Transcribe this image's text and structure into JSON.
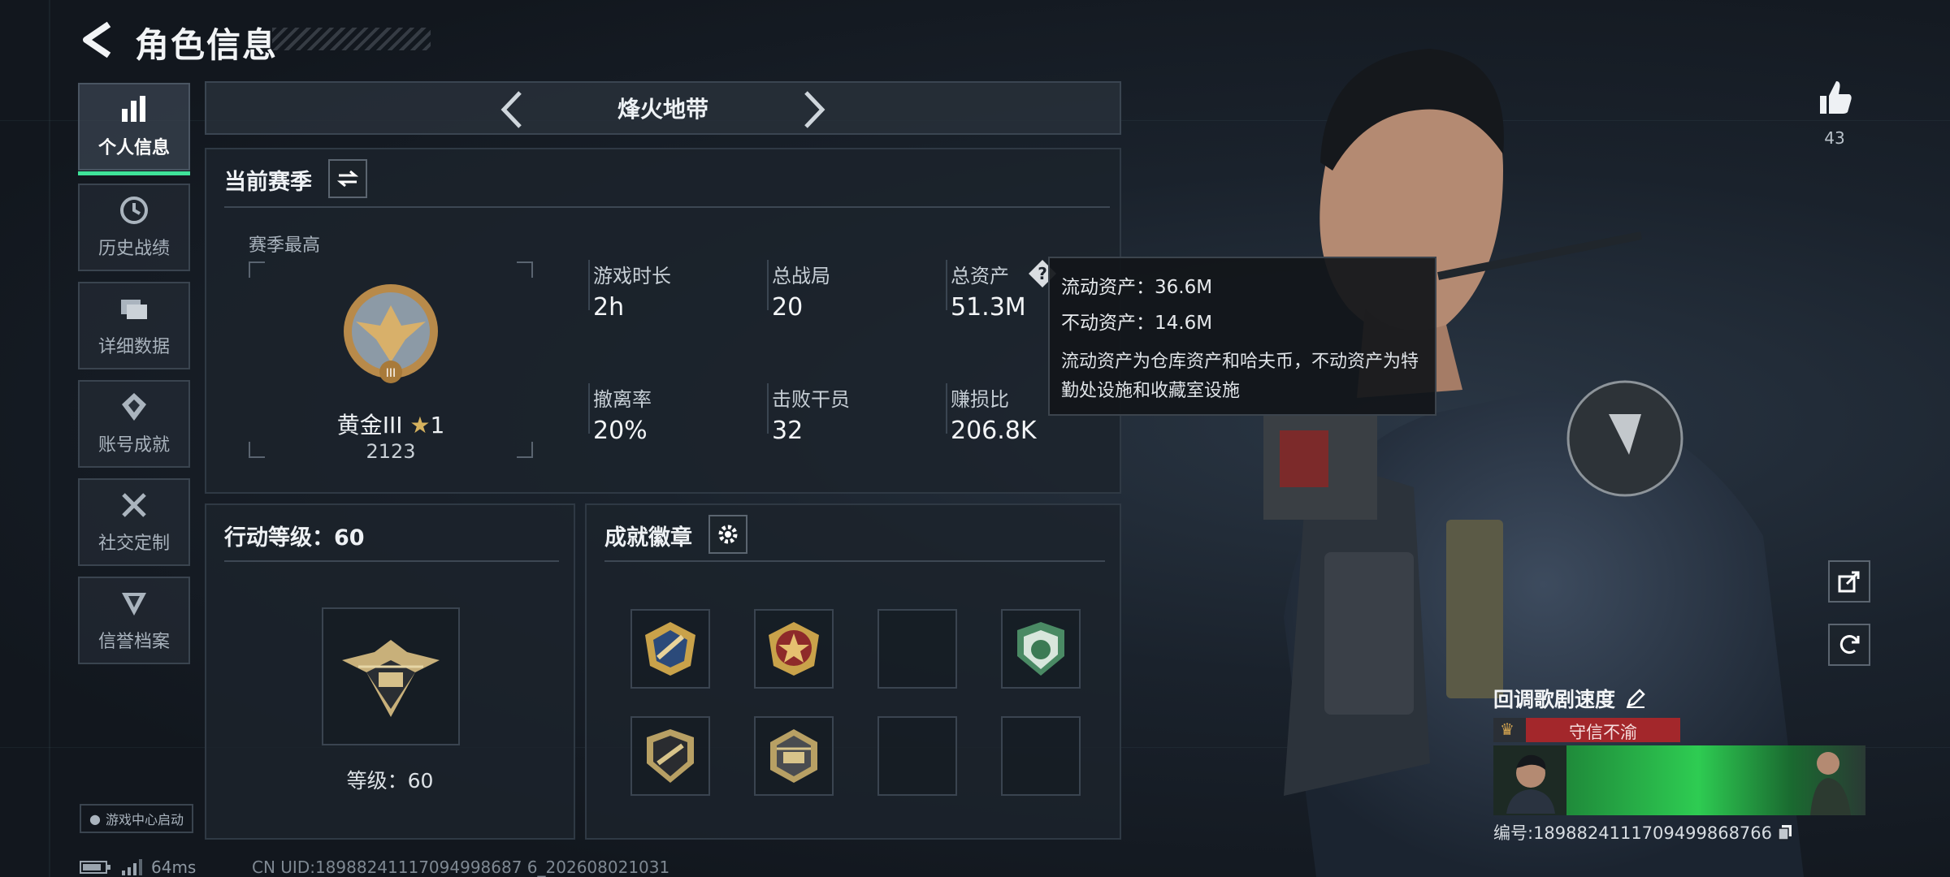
{
  "header": {
    "title": "角色信息"
  },
  "sidebar": {
    "items": [
      {
        "label": "个人信息",
        "icon": "bar-chart-icon"
      },
      {
        "label": "历史战绩",
        "icon": "history-icon"
      },
      {
        "label": "详细数据",
        "icon": "folder-icon"
      },
      {
        "label": "账号成就",
        "icon": "achievement-icon"
      },
      {
        "label": "社交定制",
        "icon": "tools-icon"
      },
      {
        "label": "信誉档案",
        "icon": "reputation-icon"
      }
    ],
    "launcher": "游戏中心启动"
  },
  "mode": {
    "label": "烽火地带"
  },
  "season": {
    "title": "当前赛季",
    "best_label": "赛季最高",
    "rank_name": "黄金III",
    "rank_stars": "1",
    "rank_score": "2123",
    "stats": [
      {
        "label": "游戏时长",
        "value": "2h"
      },
      {
        "label": "总战局",
        "value": "20"
      },
      {
        "label": "总资产",
        "value": "51.3M"
      },
      {
        "label": "撤离率",
        "value": "20%"
      },
      {
        "label": "击败干员",
        "value": "32"
      },
      {
        "label": "赚损比",
        "value": "206.8K"
      }
    ]
  },
  "tooltip": {
    "line1": "流动资产：36.6M",
    "line2": "不动资产：14.6M",
    "desc": "流动资产为仓库资产和哈夫币，不动资产为特勤处设施和收藏室设施"
  },
  "action_level": {
    "title": "行动等级：60",
    "level_text": "等级：60"
  },
  "achievements": {
    "title": "成就徽章"
  },
  "likes": {
    "count": "43"
  },
  "player_card": {
    "name": "回调歌剧速度",
    "title_badge": "守信不渝",
    "id_text": "编号:1898824111709499868766"
  },
  "footer": {
    "ping": "64ms",
    "uid": "CN UID:18988241117094998687 6_202608021031"
  },
  "colors": {
    "accent": "#3fe39a",
    "tooltip_bg": "#12151a",
    "title_badge_bg": "#a3272b"
  }
}
